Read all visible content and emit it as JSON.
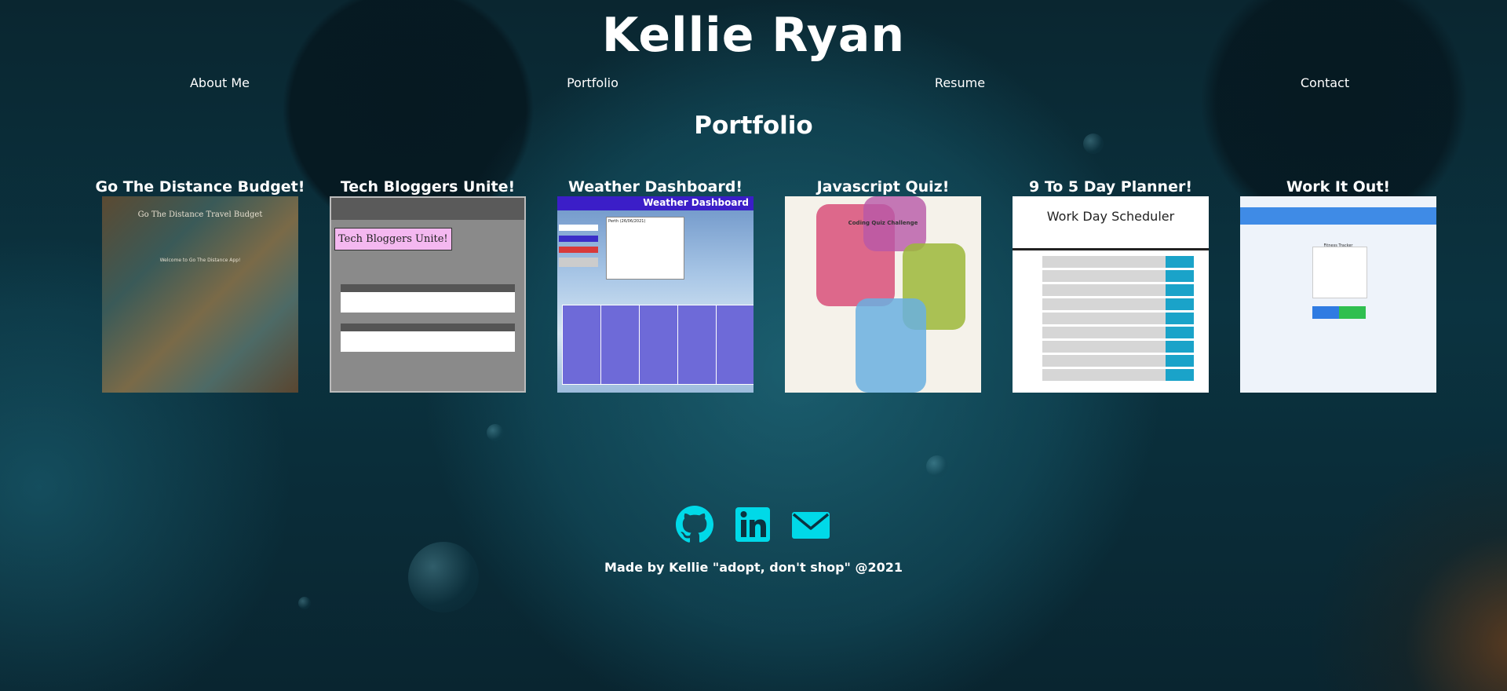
{
  "site": {
    "title": "Kellie Ryan"
  },
  "nav": {
    "items": [
      {
        "label": "About Me"
      },
      {
        "label": "Portfolio"
      },
      {
        "label": "Resume"
      },
      {
        "label": "Contact"
      }
    ]
  },
  "portfolio": {
    "heading": "Portfolio",
    "projects": [
      {
        "title": "Go The Distance Budget!",
        "thumb_heading": "Go The Distance Travel Budget",
        "thumb_text": "Welcome to Go The Distance App!"
      },
      {
        "title": "Tech Bloggers Unite!",
        "thumb_heading": "Tech Bloggers Unite!"
      },
      {
        "title": "Weather Dashboard!",
        "thumb_heading": "Weather Dashboard",
        "thumb_city": "Perth (26/06/2021)"
      },
      {
        "title": "Javascript Quiz!",
        "thumb_heading": "Coding Quiz Challenge"
      },
      {
        "title": "9 To 5 Day Planner!",
        "thumb_heading": "Work Day Scheduler"
      },
      {
        "title": "Work It Out!",
        "thumb_heading": "Fitness Tracker"
      }
    ]
  },
  "footer": {
    "social": [
      {
        "icon": "github-icon"
      },
      {
        "icon": "linkedin-icon"
      },
      {
        "icon": "email-icon"
      }
    ],
    "icon_color": "#00d9e8",
    "credit": "Made by Kellie \"adopt, don't shop\" @2021"
  }
}
